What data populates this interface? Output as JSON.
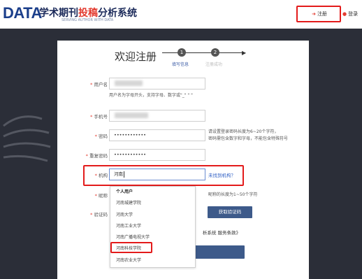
{
  "header": {
    "logo": "DATA",
    "logo_sub": "SERVING AUTHOR WITH DATA",
    "title_a": "学术期刊",
    "title_b": "投稿",
    "title_c": "分析系统",
    "register": "注册",
    "login": "登录"
  },
  "page": {
    "title": "欢迎注册",
    "steps": [
      {
        "num": "1",
        "label": "填写信息"
      },
      {
        "num": "2",
        "label": "注册成功"
      }
    ]
  },
  "form": {
    "username_label": "用户名",
    "username_hint": "用户名为字母开头，支持字母、数字或\"_\" \" \"",
    "phone_label": "手机号",
    "password_label": "密码",
    "password_value": "••••••••••••",
    "password_hint_1": "请设置登录密码长度为6~20个字符，",
    "password_hint_2": "密码需包含数字和字母，不能包含特殊符号",
    "repeat_label": "重复密码",
    "repeat_value": "••••••••••••",
    "org_label": "机构",
    "org_value": "河南",
    "org_link": "未找到机构？",
    "nickname_label": "昵称",
    "nickname_hint": "昵称的长度为1~50个字符",
    "captcha_label": "验证码",
    "captcha_button": "获取验证码",
    "terms_text": "析系统 服务条款》"
  },
  "dropdown": {
    "header": "个人用户",
    "items": [
      "河南城建学院",
      "河南大学",
      "河南工业大学",
      "河南广播电视大学",
      "河南科技学院",
      "河南农业大学"
    ]
  }
}
